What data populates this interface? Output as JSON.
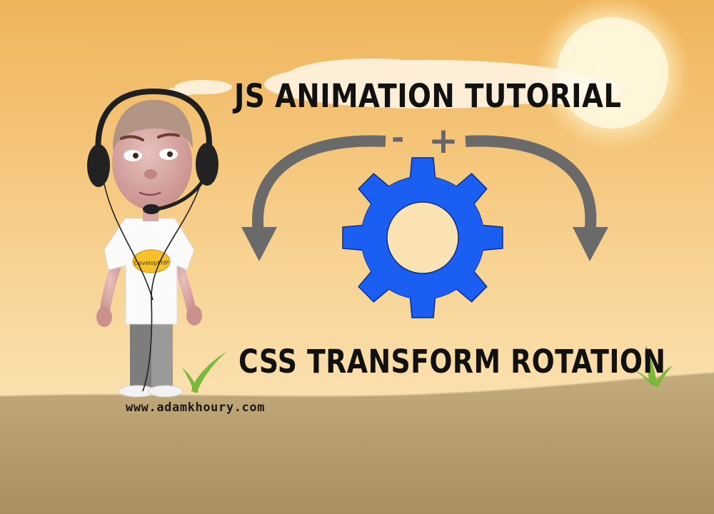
{
  "title": "JS ANIMATION TUTORIAL",
  "subtitle": "CSS TRANSFORM ROTATION",
  "website": "www.adamkhoury.com",
  "minus_symbol": "-",
  "plus_symbol": "+",
  "shirt_logo_text": "DevelopPHP",
  "colors": {
    "sky_top": "#f0b45a",
    "sky_bottom": "#fdeac6",
    "ground": "#b8a071",
    "gear": "#1a5ff2",
    "arrow": "#6a6a6a",
    "text": "#111111"
  },
  "icons": [
    "gear-icon",
    "rotate-left-arrow-icon",
    "rotate-right-arrow-icon",
    "character-illustration",
    "headset-icon",
    "sun-icon"
  ]
}
